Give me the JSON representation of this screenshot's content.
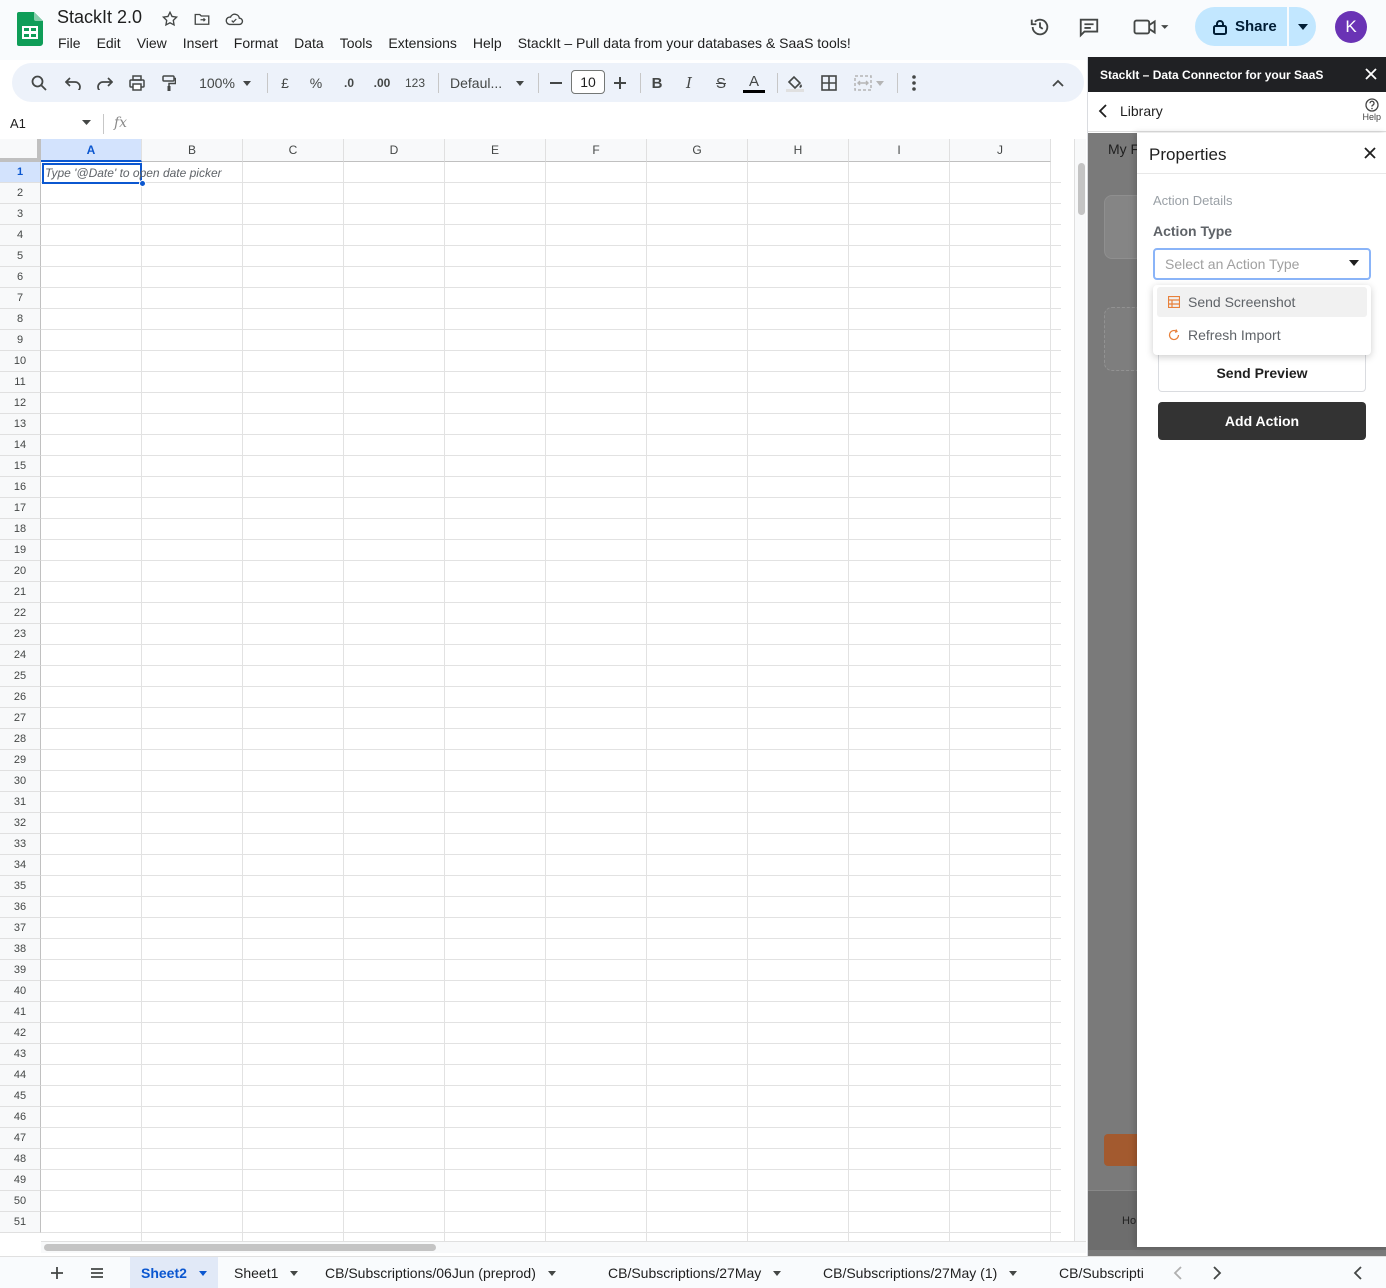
{
  "app": {
    "title": "StackIt 2.0",
    "menu": [
      "File",
      "Edit",
      "View",
      "Insert",
      "Format",
      "Data",
      "Tools",
      "Extensions",
      "Help",
      "StackIt – Pull data from your databases & SaaS tools!"
    ],
    "share_label": "Share",
    "avatar_initial": "K",
    "colors": {
      "accent": "#0b57d0",
      "share_bg": "#c2e7ff",
      "avatar": "#6a33b5",
      "sheets_green": "#0f9d58"
    }
  },
  "toolbar": {
    "zoom": "100%",
    "currency": "£",
    "percent": "%",
    "dec_decrease": ".0",
    "dec_increase": ".00",
    "format_123": "123",
    "font": "Defaul...",
    "font_size": "10",
    "bold": "B",
    "italic": "I",
    "strike": "S",
    "text_color": "A"
  },
  "formula_bar": {
    "cell_ref": "A1",
    "fx": "fx"
  },
  "grid": {
    "columns": [
      "A",
      "B",
      "C",
      "D",
      "E",
      "F",
      "G",
      "H",
      "I",
      "J"
    ],
    "rows": [
      "1",
      "2",
      "3",
      "4",
      "5",
      "6",
      "7",
      "8",
      "9",
      "10",
      "11",
      "12",
      "13",
      "14",
      "15",
      "16",
      "17",
      "18",
      "19",
      "20",
      "21",
      "22",
      "23",
      "24",
      "25",
      "26",
      "27",
      "28",
      "29",
      "30",
      "31",
      "32",
      "33",
      "34",
      "35",
      "36",
      "37",
      "38",
      "39",
      "40",
      "41",
      "42",
      "43",
      "44",
      "45",
      "46",
      "47",
      "48",
      "49",
      "50",
      "51"
    ],
    "selected_cell": "A1",
    "cell_hint": "Type '@Date' to open date picker"
  },
  "sheet_tabs": [
    {
      "label": "Sheet2",
      "active": true
    },
    {
      "label": "Sheet1",
      "active": false
    },
    {
      "label": "CB/Subscriptions/06Jun (preprod)",
      "active": false
    },
    {
      "label": "CB/Subscriptions/27May",
      "active": false
    },
    {
      "label": "CB/Subscriptions/27May (1)",
      "active": false
    },
    {
      "label": "CB/Subscripti",
      "active": false
    }
  ],
  "sidebar": {
    "title": "StackIt – Data Connector for your SaaS",
    "nav_label": "Library",
    "help_label": "Help",
    "bg_tab_label": "My Fi",
    "bg_bottom_label": "Ho",
    "properties": {
      "title": "Properties",
      "section": "Action Details",
      "action_type_label": "Action Type",
      "select_placeholder": "Select an Action Type",
      "options": [
        {
          "label": "Send Screenshot",
          "icon": "table-icon",
          "highlighted": true
        },
        {
          "label": "Refresh Import",
          "icon": "refresh-icon",
          "highlighted": false
        }
      ],
      "send_preview_label": "Send Preview",
      "add_action_label": "Add Action"
    }
  }
}
